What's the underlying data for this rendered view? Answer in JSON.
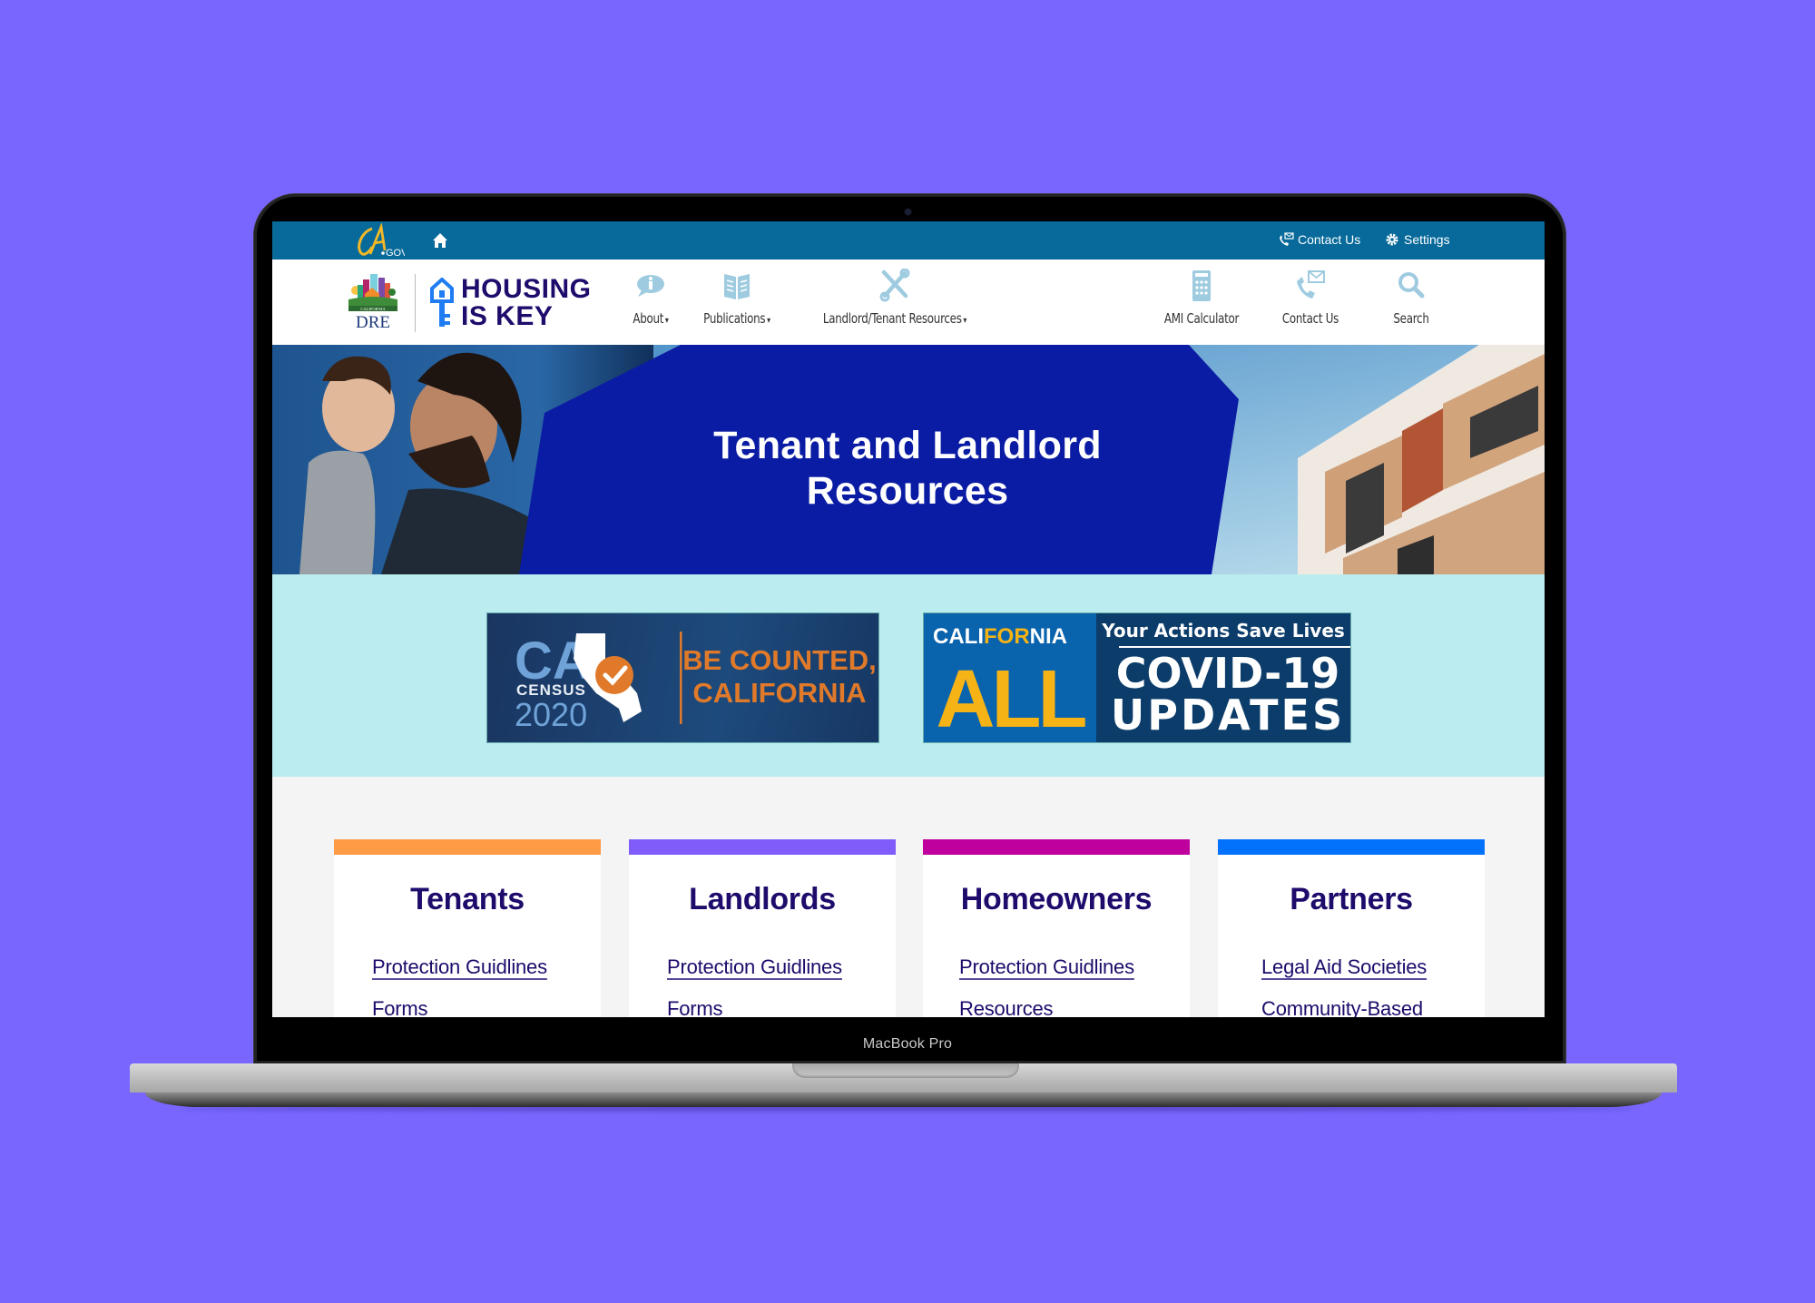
{
  "device": {
    "label": "MacBook Pro",
    "background": "#7866fe"
  },
  "topbar": {
    "logo": "CA.GOV",
    "home_icon": "home-icon",
    "utility": [
      {
        "label": "Contact Us",
        "icon": "phone-envelope-icon"
      },
      {
        "label": "Settings",
        "icon": "gear-icon"
      }
    ]
  },
  "header": {
    "agency_logo": {
      "top": "CALIFORNIA",
      "bottom": "DRE"
    },
    "brand_line1": "HOUSING",
    "brand_line2": "IS KEY",
    "nav": [
      {
        "label": "About",
        "icon": "info-bubble-icon",
        "dropdown": true
      },
      {
        "label": "Publications",
        "icon": "book-icon",
        "dropdown": true
      },
      {
        "label": "Landlord/Tenant Resources",
        "icon": "tools-icon",
        "dropdown": true
      },
      {
        "label": "AMI Calculator",
        "icon": "calculator-icon",
        "dropdown": false
      },
      {
        "label": "Contact Us",
        "icon": "phone-envelope-icon",
        "dropdown": false
      },
      {
        "label": "Search",
        "icon": "search-icon",
        "dropdown": false
      }
    ],
    "caret": "▾"
  },
  "hero": {
    "title_line1": "Tenant and Landlord",
    "title_line2": "Resources"
  },
  "banners": {
    "census": {
      "ca": "CA",
      "census": "CENSUS",
      "year": "2020",
      "line1": "BE COUNTED,",
      "line2": "CALIFORNIA"
    },
    "covid": {
      "brand_a": "CALI",
      "brand_b": "FOR",
      "brand_c": "NIA",
      "all": "ALL",
      "tagline": "Your Actions Save Lives",
      "line1": "COVID-19",
      "line2": "UPDATES"
    }
  },
  "cards": [
    {
      "title": "Tenants",
      "color": "#ff9a45",
      "links": [
        "Protection Guidlines",
        "Forms"
      ]
    },
    {
      "title": "Landlords",
      "color": "#805dfb",
      "links": [
        "Protection Guidlines",
        "Forms"
      ]
    },
    {
      "title": "Homeowners",
      "color": "#c0009e",
      "links": [
        "Protection Guidlines",
        "Resources"
      ]
    },
    {
      "title": "Partners",
      "color": "#0272fd",
      "links": [
        "Legal Aid Societies",
        "Community-Based"
      ]
    }
  ]
}
